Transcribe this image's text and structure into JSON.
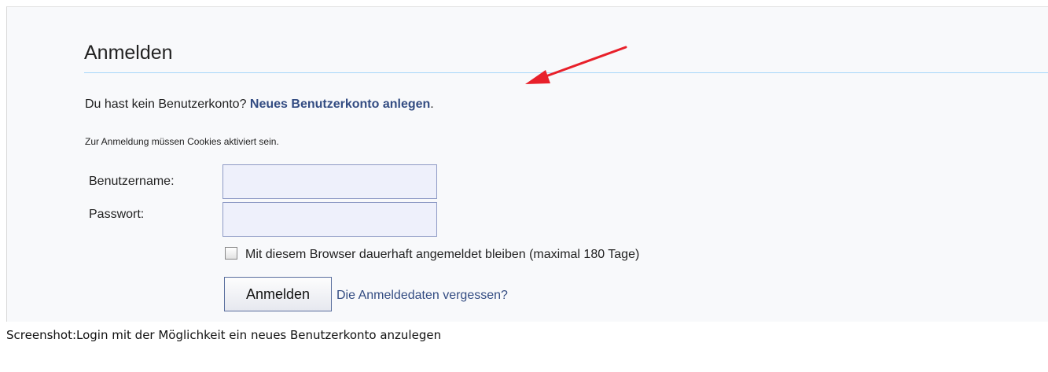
{
  "login": {
    "title": "Anmelden",
    "no_account_text": "Du hast kein Benutzerkonto?",
    "create_account_link": "Neues Benutzerkonto anlegen",
    "create_account_suffix": ".",
    "cookies_note": "Zur Anmeldung müssen Cookies aktiviert sein.",
    "username_label": "Benutzername:",
    "username_value": "",
    "password_label": "Passwort:",
    "password_value": "",
    "remember_label": "Mit diesem Browser dauerhaft angemeldet bleiben (maximal 180 Tage)",
    "remember_checked": false,
    "submit_label": "Anmelden",
    "forgot_link": "Die Anmeldedaten vergessen?"
  },
  "annotation": {
    "arrow_color": "#e8202a",
    "arrow_icon": "arrow-icon"
  },
  "caption": "Screenshot:Login mit der Möglichkeit ein neues Benutzerkonto anzulegen",
  "colors": {
    "link": "#334c82",
    "input_background": "#eef0fb",
    "input_border": "#8e9ac5",
    "panel_background": "#f8f9fb",
    "title_rule": "#a7d7f9"
  }
}
